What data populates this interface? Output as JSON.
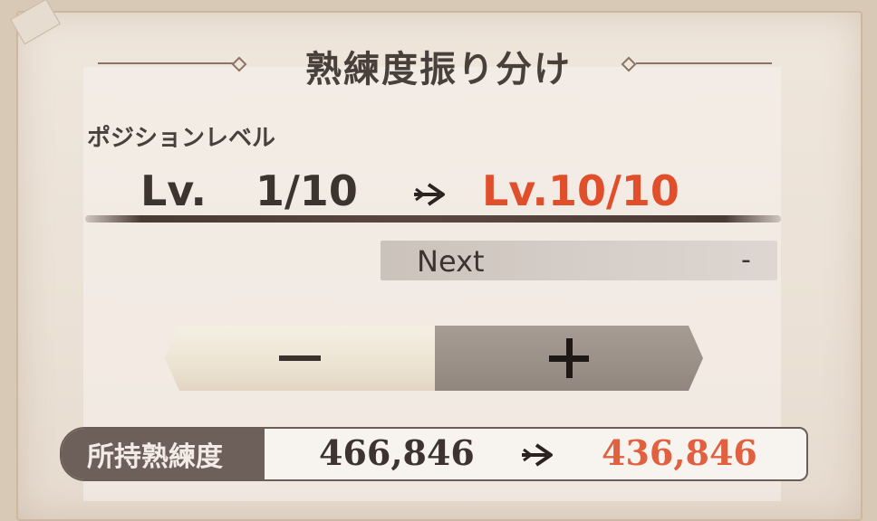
{
  "title": "熟練度振り分け",
  "position_level": {
    "label": "ポジションレベル",
    "current_prefix": "Lv.",
    "current_value": "1/10",
    "next_value": "Lv.10/10"
  },
  "next": {
    "label": "Next",
    "value": "-"
  },
  "stepper": {
    "minus_icon": "minus-icon",
    "plus_icon": "plus-icon"
  },
  "holdings": {
    "label": "所持熟練度",
    "current": "466,846",
    "after": "436,846"
  },
  "colors": {
    "accent_red": "#e04e2c",
    "text_dark": "#3d3430",
    "label_box": "#6d5f5a"
  }
}
